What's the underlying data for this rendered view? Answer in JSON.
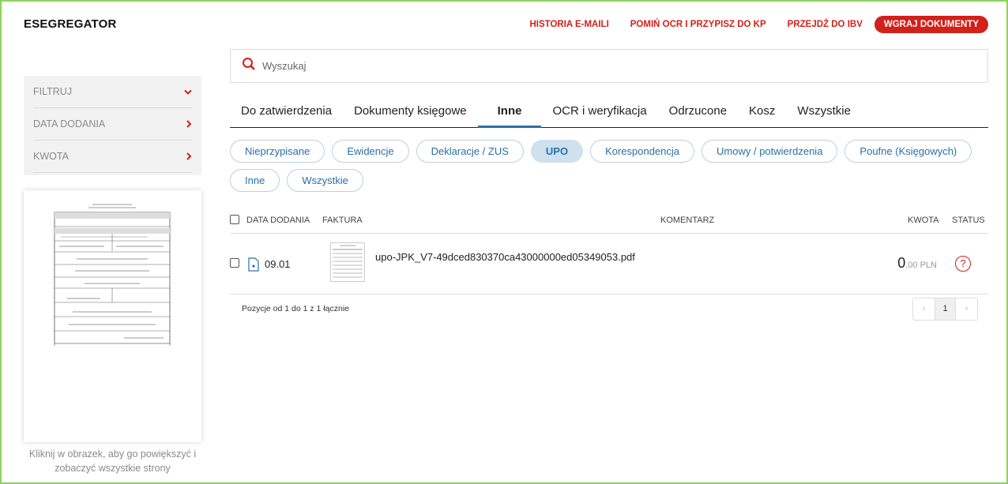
{
  "app": {
    "logo": "ESEGREGATOR"
  },
  "topnav": {
    "history": "HISTORIA E-MAILI",
    "skip_ocr": "POMIŃ OCR I PRZYPISZ DO KP",
    "go_ibv": "PRZEJDŹ DO IBV",
    "upload": "WGRAJ DOKUMENTY",
    "accent_color": "#d2201a"
  },
  "search": {
    "placeholder": "Wyszukaj",
    "value": ""
  },
  "sidebar": {
    "filters": [
      {
        "label": "FILTRUJ",
        "icon": "chevron-down-icon"
      },
      {
        "label": "DATA DODANIA",
        "icon": "chevron-right-icon"
      },
      {
        "label": "KWOTA",
        "icon": "chevron-right-icon"
      }
    ],
    "preview_hint": "Kliknij w obrazek, aby go powiększyć i zobaczyć wszystkie strony"
  },
  "tabs": [
    {
      "label": "Do zatwierdzenia"
    },
    {
      "label": "Dokumenty księgowe"
    },
    {
      "label": "Inne",
      "active": true
    },
    {
      "label": "OCR i weryfikacja"
    },
    {
      "label": "Odrzucone"
    },
    {
      "label": "Kosz"
    },
    {
      "label": "Wszystkie"
    }
  ],
  "pills": [
    {
      "label": "Nieprzypisane"
    },
    {
      "label": "Ewidencje"
    },
    {
      "label": "Deklaracje / ZUS"
    },
    {
      "label": "UPO",
      "active": true
    },
    {
      "label": "Korespondencja"
    },
    {
      "label": "Umowy / potwierdzenia"
    },
    {
      "label": "Poufne (Księgowych)"
    },
    {
      "label": "Inne"
    },
    {
      "label": "Wszystkie"
    }
  ],
  "table": {
    "columns": {
      "date": "DATA DODANIA",
      "invoice": "FAKTURA",
      "comment": "KOMENTARZ",
      "amount": "KWOTA",
      "status": "STATUS"
    },
    "rows": [
      {
        "date": "09.01",
        "file": "upo-JPK_V7-49dced830370ca43000000ed05349053.pdf",
        "amount_main": "0",
        "amount_suffix": ",00 PLN",
        "status_icon": "question-circle-icon"
      }
    ]
  },
  "pagination": {
    "info": "Pozycje od 1 do 1 z 1 łącznie",
    "prev": "‹",
    "current": "1",
    "next": "›"
  }
}
